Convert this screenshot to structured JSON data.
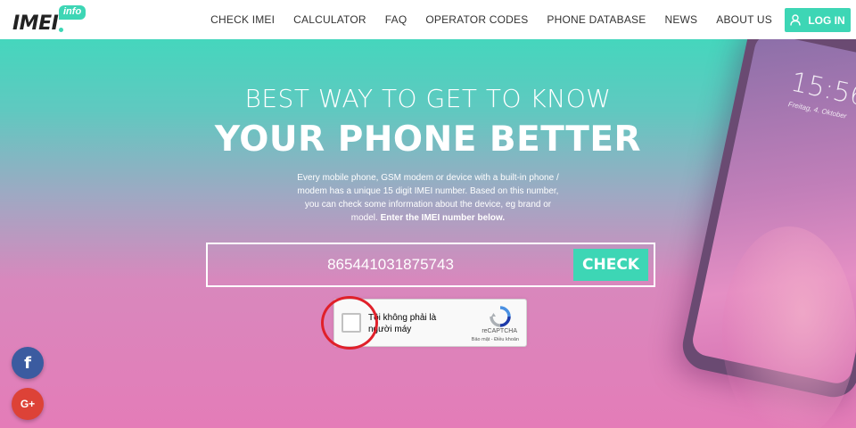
{
  "header": {
    "logo_text": "IMEI",
    "logo_badge": "info",
    "nav": [
      {
        "label": "CHECK IMEI"
      },
      {
        "label": "CALCULATOR"
      },
      {
        "label": "FAQ"
      },
      {
        "label": "OPERATOR CODES"
      },
      {
        "label": "PHONE DATABASE"
      },
      {
        "label": "NEWS"
      },
      {
        "label": "ABOUT US"
      }
    ],
    "login_label": "LOG IN",
    "login_icon": "user-icon"
  },
  "hero": {
    "title_top": "BEST WAY TO GET TO KNOW",
    "title_main": "YOUR PHONE BETTER",
    "description": "Every mobile phone, GSM modem or device with a built-in phone / modem has a unique 15 digit IMEI number. Based on this number, you can check some information about the device, eg brand or model.",
    "description_strong": "Enter the IMEI number below.",
    "imei_value": "865441031875743",
    "check_label": "CHECK",
    "phone_time": "15:56",
    "phone_date": "Freitag, 4. Oktober"
  },
  "captcha": {
    "label": "Tôi không phải là người máy",
    "brand": "reCAPTCHA",
    "links": "Bảo mật - Điều khoản"
  },
  "social": {
    "facebook": "f",
    "google_plus": "G+"
  },
  "colors": {
    "accent": "#3dd6b5",
    "annotation": "#e0202a"
  }
}
